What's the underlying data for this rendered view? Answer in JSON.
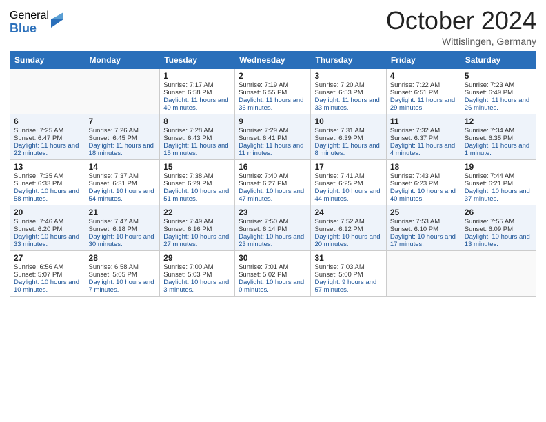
{
  "logo": {
    "general": "General",
    "blue": "Blue"
  },
  "header": {
    "month": "October 2024",
    "location": "Wittislingen, Germany"
  },
  "weekdays": [
    "Sunday",
    "Monday",
    "Tuesday",
    "Wednesday",
    "Thursday",
    "Friday",
    "Saturday"
  ],
  "weeks": [
    [
      {
        "day": "",
        "sunrise": "",
        "sunset": "",
        "daylight": ""
      },
      {
        "day": "",
        "sunrise": "",
        "sunset": "",
        "daylight": ""
      },
      {
        "day": "1",
        "sunrise": "Sunrise: 7:17 AM",
        "sunset": "Sunset: 6:58 PM",
        "daylight": "Daylight: 11 hours and 40 minutes."
      },
      {
        "day": "2",
        "sunrise": "Sunrise: 7:19 AM",
        "sunset": "Sunset: 6:55 PM",
        "daylight": "Daylight: 11 hours and 36 minutes."
      },
      {
        "day": "3",
        "sunrise": "Sunrise: 7:20 AM",
        "sunset": "Sunset: 6:53 PM",
        "daylight": "Daylight: 11 hours and 33 minutes."
      },
      {
        "day": "4",
        "sunrise": "Sunrise: 7:22 AM",
        "sunset": "Sunset: 6:51 PM",
        "daylight": "Daylight: 11 hours and 29 minutes."
      },
      {
        "day": "5",
        "sunrise": "Sunrise: 7:23 AM",
        "sunset": "Sunset: 6:49 PM",
        "daylight": "Daylight: 11 hours and 26 minutes."
      }
    ],
    [
      {
        "day": "6",
        "sunrise": "Sunrise: 7:25 AM",
        "sunset": "Sunset: 6:47 PM",
        "daylight": "Daylight: 11 hours and 22 minutes."
      },
      {
        "day": "7",
        "sunrise": "Sunrise: 7:26 AM",
        "sunset": "Sunset: 6:45 PM",
        "daylight": "Daylight: 11 hours and 18 minutes."
      },
      {
        "day": "8",
        "sunrise": "Sunrise: 7:28 AM",
        "sunset": "Sunset: 6:43 PM",
        "daylight": "Daylight: 11 hours and 15 minutes."
      },
      {
        "day": "9",
        "sunrise": "Sunrise: 7:29 AM",
        "sunset": "Sunset: 6:41 PM",
        "daylight": "Daylight: 11 hours and 11 minutes."
      },
      {
        "day": "10",
        "sunrise": "Sunrise: 7:31 AM",
        "sunset": "Sunset: 6:39 PM",
        "daylight": "Daylight: 11 hours and 8 minutes."
      },
      {
        "day": "11",
        "sunrise": "Sunrise: 7:32 AM",
        "sunset": "Sunset: 6:37 PM",
        "daylight": "Daylight: 11 hours and 4 minutes."
      },
      {
        "day": "12",
        "sunrise": "Sunrise: 7:34 AM",
        "sunset": "Sunset: 6:35 PM",
        "daylight": "Daylight: 11 hours and 1 minute."
      }
    ],
    [
      {
        "day": "13",
        "sunrise": "Sunrise: 7:35 AM",
        "sunset": "Sunset: 6:33 PM",
        "daylight": "Daylight: 10 hours and 58 minutes."
      },
      {
        "day": "14",
        "sunrise": "Sunrise: 7:37 AM",
        "sunset": "Sunset: 6:31 PM",
        "daylight": "Daylight: 10 hours and 54 minutes."
      },
      {
        "day": "15",
        "sunrise": "Sunrise: 7:38 AM",
        "sunset": "Sunset: 6:29 PM",
        "daylight": "Daylight: 10 hours and 51 minutes."
      },
      {
        "day": "16",
        "sunrise": "Sunrise: 7:40 AM",
        "sunset": "Sunset: 6:27 PM",
        "daylight": "Daylight: 10 hours and 47 minutes."
      },
      {
        "day": "17",
        "sunrise": "Sunrise: 7:41 AM",
        "sunset": "Sunset: 6:25 PM",
        "daylight": "Daylight: 10 hours and 44 minutes."
      },
      {
        "day": "18",
        "sunrise": "Sunrise: 7:43 AM",
        "sunset": "Sunset: 6:23 PM",
        "daylight": "Daylight: 10 hours and 40 minutes."
      },
      {
        "day": "19",
        "sunrise": "Sunrise: 7:44 AM",
        "sunset": "Sunset: 6:21 PM",
        "daylight": "Daylight: 10 hours and 37 minutes."
      }
    ],
    [
      {
        "day": "20",
        "sunrise": "Sunrise: 7:46 AM",
        "sunset": "Sunset: 6:20 PM",
        "daylight": "Daylight: 10 hours and 33 minutes."
      },
      {
        "day": "21",
        "sunrise": "Sunrise: 7:47 AM",
        "sunset": "Sunset: 6:18 PM",
        "daylight": "Daylight: 10 hours and 30 minutes."
      },
      {
        "day": "22",
        "sunrise": "Sunrise: 7:49 AM",
        "sunset": "Sunset: 6:16 PM",
        "daylight": "Daylight: 10 hours and 27 minutes."
      },
      {
        "day": "23",
        "sunrise": "Sunrise: 7:50 AM",
        "sunset": "Sunset: 6:14 PM",
        "daylight": "Daylight: 10 hours and 23 minutes."
      },
      {
        "day": "24",
        "sunrise": "Sunrise: 7:52 AM",
        "sunset": "Sunset: 6:12 PM",
        "daylight": "Daylight: 10 hours and 20 minutes."
      },
      {
        "day": "25",
        "sunrise": "Sunrise: 7:53 AM",
        "sunset": "Sunset: 6:10 PM",
        "daylight": "Daylight: 10 hours and 17 minutes."
      },
      {
        "day": "26",
        "sunrise": "Sunrise: 7:55 AM",
        "sunset": "Sunset: 6:09 PM",
        "daylight": "Daylight: 10 hours and 13 minutes."
      }
    ],
    [
      {
        "day": "27",
        "sunrise": "Sunrise: 6:56 AM",
        "sunset": "Sunset: 5:07 PM",
        "daylight": "Daylight: 10 hours and 10 minutes."
      },
      {
        "day": "28",
        "sunrise": "Sunrise: 6:58 AM",
        "sunset": "Sunset: 5:05 PM",
        "daylight": "Daylight: 10 hours and 7 minutes."
      },
      {
        "day": "29",
        "sunrise": "Sunrise: 7:00 AM",
        "sunset": "Sunset: 5:03 PM",
        "daylight": "Daylight: 10 hours and 3 minutes."
      },
      {
        "day": "30",
        "sunrise": "Sunrise: 7:01 AM",
        "sunset": "Sunset: 5:02 PM",
        "daylight": "Daylight: 10 hours and 0 minutes."
      },
      {
        "day": "31",
        "sunrise": "Sunrise: 7:03 AM",
        "sunset": "Sunset: 5:00 PM",
        "daylight": "Daylight: 9 hours and 57 minutes."
      },
      {
        "day": "",
        "sunrise": "",
        "sunset": "",
        "daylight": ""
      },
      {
        "day": "",
        "sunrise": "",
        "sunset": "",
        "daylight": ""
      }
    ]
  ]
}
